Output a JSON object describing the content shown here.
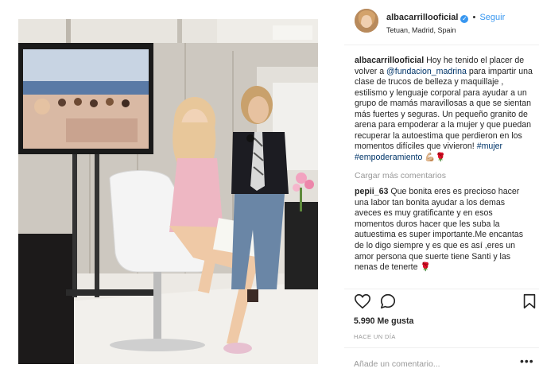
{
  "post": {
    "author": {
      "username": "albacarrillooficial",
      "verified_mark": "✓",
      "separator": "•",
      "follow_label": "Seguir",
      "location": "Tetuan, Madrid, Spain",
      "avatar_icon": "profile-photo"
    },
    "caption": {
      "username": "albacarrillooficial",
      "text_intro": "Hoy he tenido el placer de volver a",
      "mention": "@fundacion_madrina",
      "text_body": "para impartir una clase de trucos de belleza y maquillaje , estilismo y lenguaje corporal para ayudar a un grupo de mamás maravillosas a que se sientan más fuertes y seguras. Un pequeño granito de arena para empoderar a la mujer y que puedan recuperar la autoestima que perdieron en los momentos difíciles que vivieron!",
      "hashtags": "#mujer #empoderamiento",
      "emoji": "💪🏼🌹"
    },
    "load_more_label": "Cargar más comentarios",
    "comments": [
      {
        "username": "pepii_63",
        "text": "Que bonita eres es precioso hacer una labor tan bonita ayudar a los demas aveces es muy gratificante y en esos momentos duros hacer que les suba la autuestima es super importante.Me encantas de lo digo siempre y es que es así ,eres un amor persona que suerte tiene Santi y las nenas de tenerte 🌹"
      }
    ],
    "likes_label": "5.990 Me gusta",
    "timestamp": "HACE UN DÍA",
    "comment_placeholder": "Añade un comentario...",
    "more_label": "•••",
    "icons": {
      "like": "heart-icon",
      "comment": "speech-bubble-icon",
      "save": "bookmark-icon",
      "verified": "verified-badge-icon"
    },
    "colors": {
      "link_blue": "#3897f0",
      "hashtag_navy": "#003569",
      "muted_gray": "#999999",
      "text_dark": "#262626"
    }
  }
}
